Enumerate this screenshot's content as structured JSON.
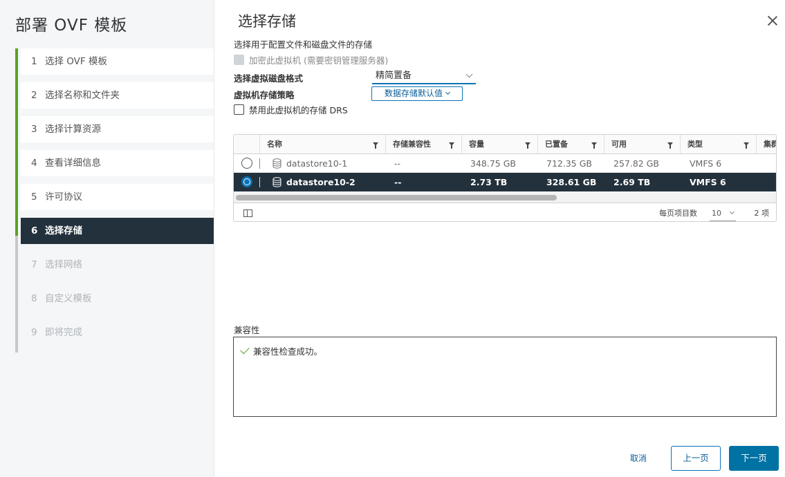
{
  "wizard": {
    "title": "部署 OVF 模板",
    "steps": [
      {
        "num": "1",
        "label": "选择 OVF 模板"
      },
      {
        "num": "2",
        "label": "选择名称和文件夹"
      },
      {
        "num": "3",
        "label": "选择计算资源"
      },
      {
        "num": "4",
        "label": "查看详细信息"
      },
      {
        "num": "5",
        "label": "许可协议"
      },
      {
        "num": "6",
        "label": "选择存储"
      },
      {
        "num": "7",
        "label": "选择网络"
      },
      {
        "num": "8",
        "label": "自定义模板"
      },
      {
        "num": "9",
        "label": "即将完成"
      }
    ]
  },
  "page": {
    "title": "选择存储",
    "subtitle": "选择用于配置文件和磁盘文件的存储",
    "encrypt_label": "加密此虚拟机 (需要密钥管理服务器)",
    "disk_format_label": "选择虚拟磁盘格式",
    "disk_format_value": "精简置备",
    "storage_policy_label": "虚拟机存储策略",
    "storage_policy_value": "数据存储默认值",
    "drs_label": "禁用此虚拟机的存储 DRS"
  },
  "grid": {
    "columns": [
      "名称",
      "存储兼容性",
      "容量",
      "已置备",
      "可用",
      "类型",
      "集群"
    ],
    "rows": [
      {
        "name": "datastore10-1",
        "compat": "--",
        "capacity": "348.75 GB",
        "provisioned": "712.35 GB",
        "free": "257.82 GB",
        "type": "VMFS 6",
        "selected": false
      },
      {
        "name": "datastore10-2",
        "compat": "--",
        "capacity": "2.73 TB",
        "provisioned": "328.61 GB",
        "free": "2.69 TB",
        "type": "VMFS 6",
        "selected": true
      }
    ],
    "footer": {
      "per_page_label": "每页项目数",
      "per_page_value": "10",
      "total": "2 项"
    }
  },
  "compatibility": {
    "label": "兼容性",
    "message": "兼容性检查成功。"
  },
  "buttons": {
    "cancel": "取消",
    "back": "上一页",
    "next": "下一页"
  },
  "colors": {
    "accent": "#0072a3",
    "selected_row": "#23313c",
    "success": "#5aa220"
  }
}
